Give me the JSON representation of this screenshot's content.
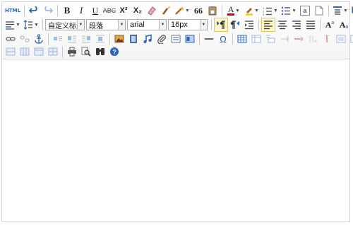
{
  "toolbar": {
    "html_label": "HTML",
    "bold": "B",
    "italic": "I",
    "underline": "U",
    "strike": "ABC",
    "superscript": "X²",
    "subscript": "X₂",
    "blockquote": "66",
    "font_color_label": "A",
    "text_dir_label": "a",
    "heading_select": "自定义标题",
    "paragraph_select": "段落",
    "font_family_select": "arial",
    "font_size_select": "16px",
    "omega": "Ω",
    "fontsize_up": "A",
    "fontsize_down": "A"
  },
  "colors": {
    "accent_blue": "#2a62b8",
    "active_bg": "#fff6c7",
    "font_color_bar": "#cc0000",
    "highlight_bar": "#ffd800"
  },
  "content": {
    "text": ""
  }
}
